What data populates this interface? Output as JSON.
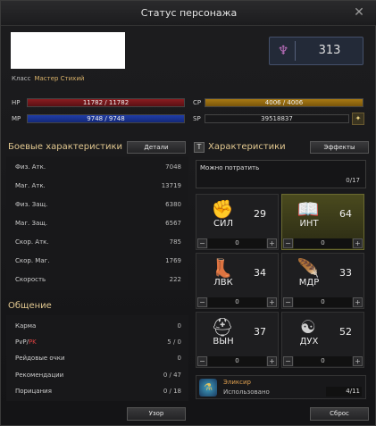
{
  "window": {
    "title": "Статус персонажа"
  },
  "character": {
    "class_label": "Класс",
    "class_value": "Мастер Стихий",
    "level": "313"
  },
  "bars": {
    "hp_label": "HP",
    "hp_value": "11782 / 11782",
    "mp_label": "MP",
    "mp_value": "9748 / 9748",
    "cp_label": "CP",
    "cp_value": "4006 / 4006",
    "sp_label": "SP",
    "sp_value": "39518837"
  },
  "combat": {
    "title": "Боевые характеристики",
    "details_button": "Детали",
    "rows": [
      {
        "label": "Физ. Атк.",
        "value": "7048"
      },
      {
        "label": "Маг. Атк.",
        "value": "13719"
      },
      {
        "label": "Физ. Защ.",
        "value": "6380"
      },
      {
        "label": "Маг. Защ.",
        "value": "6567"
      },
      {
        "label": "Скор. Атк.",
        "value": "785"
      },
      {
        "label": "Скор. Маг.",
        "value": "1769"
      },
      {
        "label": "Скорость",
        "value": "222"
      }
    ]
  },
  "communication": {
    "title": "Общение",
    "rows": [
      {
        "label": "Карма",
        "value": "0"
      },
      {
        "label_a": "PvP/",
        "label_b": "PK",
        "value": "5 / 0"
      },
      {
        "label": "Рейдовые очки",
        "value": "0"
      },
      {
        "label": "Рекомендации",
        "value": "0 / 47"
      },
      {
        "label": "Порицания",
        "value": "0 / 18"
      }
    ]
  },
  "characteristics": {
    "title": "Характеристики",
    "title_box": "T",
    "effects_button": "Эффекты",
    "spend_label": "Можно потратить",
    "spend_value": "0/17",
    "stats": [
      {
        "name": "СИЛ",
        "value": "29",
        "control": "0",
        "icon": "fist-icon"
      },
      {
        "name": "ИНТ",
        "value": "64",
        "control": "0",
        "icon": "book-icon"
      },
      {
        "name": "ЛВК",
        "value": "34",
        "control": "0",
        "icon": "boot-icon"
      },
      {
        "name": "МДР",
        "value": "33",
        "control": "0",
        "icon": "feather-icon"
      },
      {
        "name": "ВЫН",
        "value": "37",
        "control": "0",
        "icon": "helmet-icon"
      },
      {
        "name": "ДУХ",
        "value": "52",
        "control": "0",
        "icon": "spirit-icon"
      }
    ],
    "minus": "−",
    "plus": "+"
  },
  "elixir": {
    "name": "Эликсир",
    "status": "Использовано",
    "count": "4/11"
  },
  "footer": {
    "view_button": "Узор",
    "reset_button": "Сброс"
  }
}
